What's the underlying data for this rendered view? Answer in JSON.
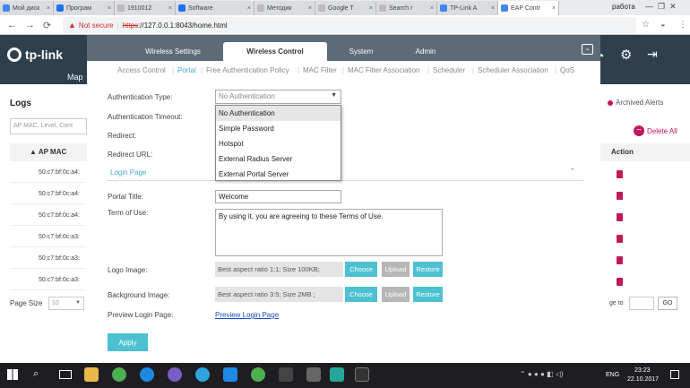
{
  "browser": {
    "tabs": [
      {
        "label": "Мой диск",
        "color": "#4285f4"
      },
      {
        "label": "Програм",
        "color": "#1a73e8"
      },
      {
        "label": "1910012",
        "color": "#999999"
      },
      {
        "label": "Software",
        "color": "#1a73e8"
      },
      {
        "label": "Методик",
        "color": "#999999"
      },
      {
        "label": "Google T",
        "color": "#999999"
      },
      {
        "label": "Search r",
        "color": "#999999"
      },
      {
        "label": "TP-Link A",
        "color": "#4285f4"
      },
      {
        "label": "EAP Contr",
        "color": "#4285f4"
      }
    ],
    "profile": "работа",
    "not_secure": "Not secure",
    "url_scheme": "https",
    "url_rest": "://127.0.0.1:8043/home.html"
  },
  "app": {
    "logo": "tp-link",
    "nav_map": "Map",
    "logs_title": "Logs",
    "search_placeholder": "AP MAC, Level, Cont",
    "col_ap_mac": "▲ AP MAC",
    "col_action": "Action",
    "archived": "Archived Alerts",
    "delete_all": "Delete All",
    "rows": [
      "50:c7:bf:0c:a4:",
      "50:c7:bf:0c:a4:",
      "50:c7:bf:0c:a4:",
      "50:c7:bf:0c:a3:",
      "50:c7:bf:0c:a3:",
      "50:c7:bf:0c:a3:"
    ],
    "page_size_label": "Page Size",
    "page_size": "10",
    "goto_label": "ge to",
    "go": "GO"
  },
  "modal": {
    "tabs": [
      "Wireless Settings",
      "Wireless Control",
      "System",
      "Admin"
    ],
    "subtabs": [
      "Access Control",
      "Portal",
      "Free Authentication Policy",
      "MAC Filter",
      "MAC Filter Association",
      "Scheduler",
      "Scheduler Association",
      "QoS"
    ],
    "auth_type_label": "Authentication Type:",
    "auth_type_value": "No Authentication",
    "auth_timeout_label": "Authentication Timeout:",
    "redirect_label": "Redirect:",
    "redirect_url_label": "Redirect URL:",
    "options": [
      "No Authentication",
      "Simple Password",
      "Hotspot",
      "External Radius Server",
      "External Portal Server"
    ],
    "login_page": "Login Page",
    "portal_title_label": "Portal Title:",
    "portal_title_value": "Welcome",
    "terms_label": "Term of Use:",
    "terms_value": "By using it, you are agreeing to these Terms of Use.",
    "logo_label": "Logo Image:",
    "logo_note": "Best aspect ratio 1:1; Size 100KB;",
    "bg_label": "Background Image:",
    "bg_note": "Best aspect ratio 3:5; Size 2MB ;",
    "choose": "Choose",
    "upload": "Upload",
    "restore": "Restore",
    "preview_label": "Preview Login Page:",
    "preview_link": "Preview Login Page",
    "apply": "Apply"
  },
  "taskbar": {
    "lang": "ENG",
    "time": "23:23",
    "date": "22.10.2017"
  }
}
